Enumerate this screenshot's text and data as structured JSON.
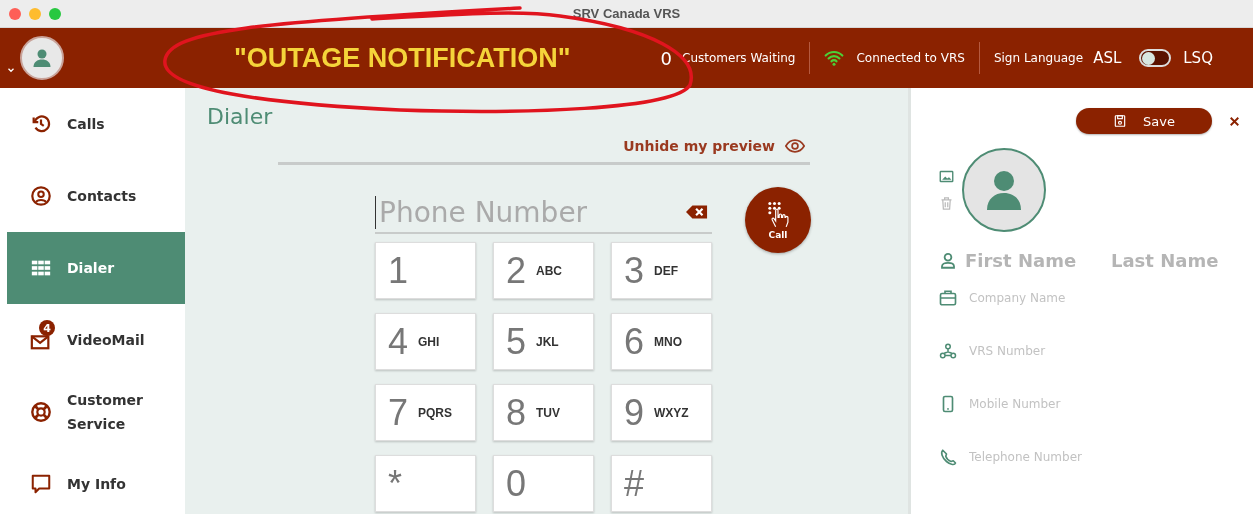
{
  "window": {
    "title": "SRV Canada VRS"
  },
  "header": {
    "notification": "\"OUTAGE NOTIFICATION\"",
    "waiting_count": "0",
    "waiting_label": "Customers Waiting",
    "connection": "Connected to VRS",
    "sign_language_label": "Sign Language",
    "language_left": "ASL",
    "language_right": "LSQ",
    "toggle_on": false
  },
  "sidebar": {
    "items": [
      {
        "label": "Calls",
        "selected": false
      },
      {
        "label": "Contacts",
        "selected": false
      },
      {
        "label": "Dialer",
        "selected": true
      },
      {
        "label": "VideoMail",
        "badge": "4",
        "selected": false
      },
      {
        "label": "Customer Service",
        "selected": false
      },
      {
        "label": "My Info",
        "selected": false
      }
    ]
  },
  "dialer": {
    "title": "Dialer",
    "preview_link": "Unhide my preview",
    "phone_field": {
      "placeholder": "Phone Number"
    },
    "call_button": "Call",
    "keys": [
      {
        "digit": "1"
      },
      {
        "digit": "2",
        "letters": "ABC"
      },
      {
        "digit": "3",
        "letters": "DEF"
      },
      {
        "digit": "4",
        "letters": "GHI"
      },
      {
        "digit": "5",
        "letters": "JKL"
      },
      {
        "digit": "6",
        "letters": "MNO"
      },
      {
        "digit": "7",
        "letters": "PQRS"
      },
      {
        "digit": "8",
        "letters": "TUV"
      },
      {
        "digit": "9",
        "letters": "WXYZ"
      },
      {
        "digit": "*"
      },
      {
        "digit": "0"
      },
      {
        "digit": "#"
      }
    ]
  },
  "contact_form": {
    "save_button": "Save",
    "first_name": {
      "placeholder": "First Name"
    },
    "last_name": {
      "placeholder": "Last Name"
    },
    "fields": [
      {
        "placeholder": "Company Name"
      },
      {
        "placeholder": "VRS Number"
      },
      {
        "placeholder": "Mobile Number"
      },
      {
        "placeholder": "Telephone Number"
      }
    ]
  }
}
